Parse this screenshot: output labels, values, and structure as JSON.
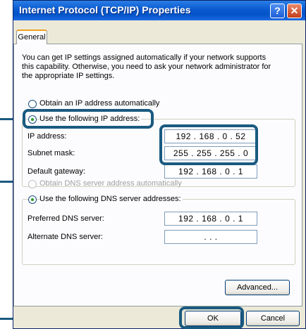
{
  "window": {
    "title": "Internet Protocol (TCP/IP) Properties",
    "help_glyph": "?",
    "close_glyph": "✕"
  },
  "tabs": [
    {
      "label": "General"
    }
  ],
  "intro": {
    "line1": "You can get IP settings assigned automatically if your network supports",
    "line2": "this capability. Otherwise, you need to ask your network administrator for",
    "line3": "the appropriate IP settings."
  },
  "ip_options": {
    "auto_label": "Obtain an IP address automatically",
    "manual_label": "Use the following IP address:",
    "selected": "manual"
  },
  "ip_fields": [
    {
      "label": "IP address:",
      "value": "192 . 168 .  0  . 52"
    },
    {
      "label": "Subnet mask:",
      "value": "255 . 255 . 255 .  0"
    },
    {
      "label": "Default gateway:",
      "value": "192 . 168 .  0  .  1"
    }
  ],
  "dns_options": {
    "auto_label": "Obtain DNS server address automatically",
    "manual_label": "Use the following DNS server addresses:",
    "selected": "manual"
  },
  "dns_fields": [
    {
      "label": "Preferred DNS server:",
      "value": "192 . 168 .  0  .  1"
    },
    {
      "label": "Alternate DNS server:",
      "value": ".        .        ."
    }
  ],
  "buttons": {
    "advanced": "Advanced...",
    "ok": "OK",
    "cancel": "Cancel"
  },
  "colors": {
    "highlight": "#1a5a80",
    "titlebar": "#0a5ad0",
    "radio_dot": "#2a9e2a"
  }
}
